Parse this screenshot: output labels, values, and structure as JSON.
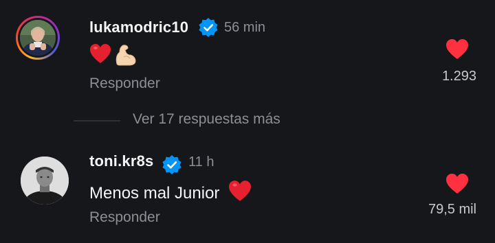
{
  "comments": [
    {
      "username": "lukamodric10",
      "verified": true,
      "time": "56 min",
      "text": "",
      "emojis": [
        "red-heart",
        "flexed-biceps"
      ],
      "reply_label": "Responder",
      "likes": "1.293"
    },
    {
      "username": "toni.kr8s",
      "verified": true,
      "time": "11 h",
      "text": "Menos mal Junior",
      "emojis": [
        "red-heart"
      ],
      "reply_label": "Responder",
      "likes": "79,5 mil"
    }
  ],
  "view_more": {
    "label": "Ver 17 respuestas más"
  },
  "colors": {
    "background": "#16171b",
    "heart": "#ff3040",
    "verified": "#0095f6",
    "muted": "#8d8f94"
  }
}
